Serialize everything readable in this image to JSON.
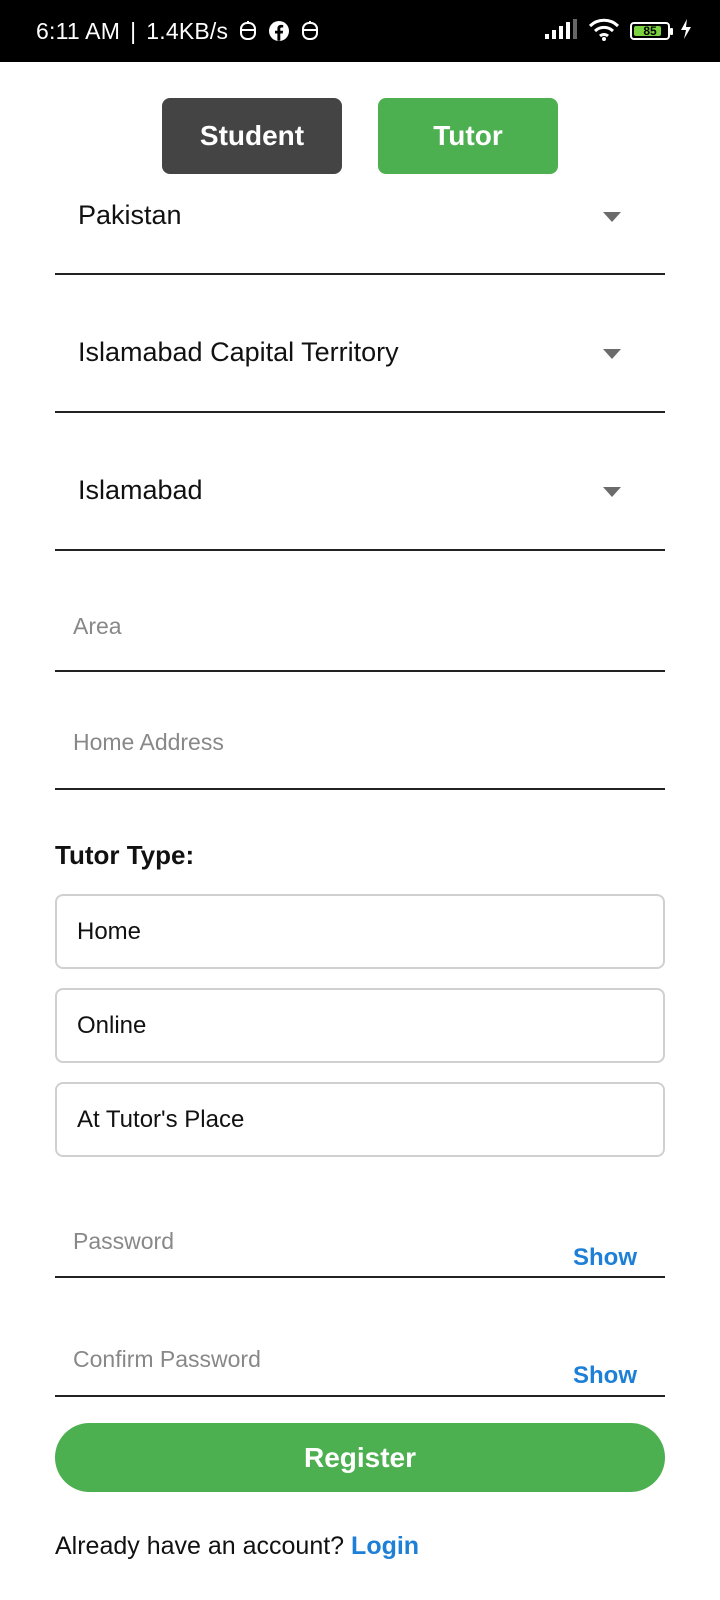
{
  "status_bar": {
    "time": "6:11 AM",
    "separator": "|",
    "net_speed": "1.4KB/s",
    "notification_icons": [
      "app-notification-icon",
      "facebook-icon",
      "app-notification-icon"
    ],
    "battery_level": "85",
    "battery_percent": 0.85,
    "indicators": [
      "signal-icon",
      "wifi-icon",
      "battery-icon",
      "charging-icon"
    ]
  },
  "role_toggle": {
    "student_label": "Student",
    "tutor_label": "Tutor",
    "selected": "Tutor"
  },
  "form": {
    "country": "Pakistan",
    "province": "Islamabad Capital Territory",
    "city": "Islamabad",
    "area_placeholder": "Area",
    "address_placeholder": "Home Address",
    "tutor_type_label": "Tutor Type:",
    "tutor_types": [
      "Home",
      "Online",
      "At Tutor's Place"
    ],
    "password_placeholder": "Password",
    "confirm_password_placeholder": "Confirm Password",
    "show_label": "Show",
    "register_label": "Register",
    "footer_text": "Already have an account?",
    "login_label": "Login"
  },
  "colors": {
    "accent_green": "#4caf50",
    "student_gray": "#444444",
    "link_blue": "#1e7fd6",
    "status_bar_bg": "#000000"
  }
}
